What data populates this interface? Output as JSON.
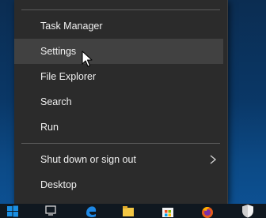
{
  "menu": {
    "items": [
      {
        "label": "Task Manager"
      },
      {
        "label": "Settings"
      },
      {
        "label": "File Explorer"
      },
      {
        "label": "Search"
      },
      {
        "label": "Run"
      },
      {
        "label": "Shut down or sign out"
      },
      {
        "label": "Desktop"
      }
    ],
    "hovered": "Settings"
  },
  "taskbar": {
    "icons": [
      "start-icon",
      "task-view-icon",
      "edge-icon",
      "file-explorer-icon",
      "store-icon",
      "firefox-icon",
      "security-shield-icon"
    ]
  },
  "colors": {
    "menu_bg": "#2b2b2b",
    "hover_bg": "#414141",
    "accent": "#0078d7"
  }
}
